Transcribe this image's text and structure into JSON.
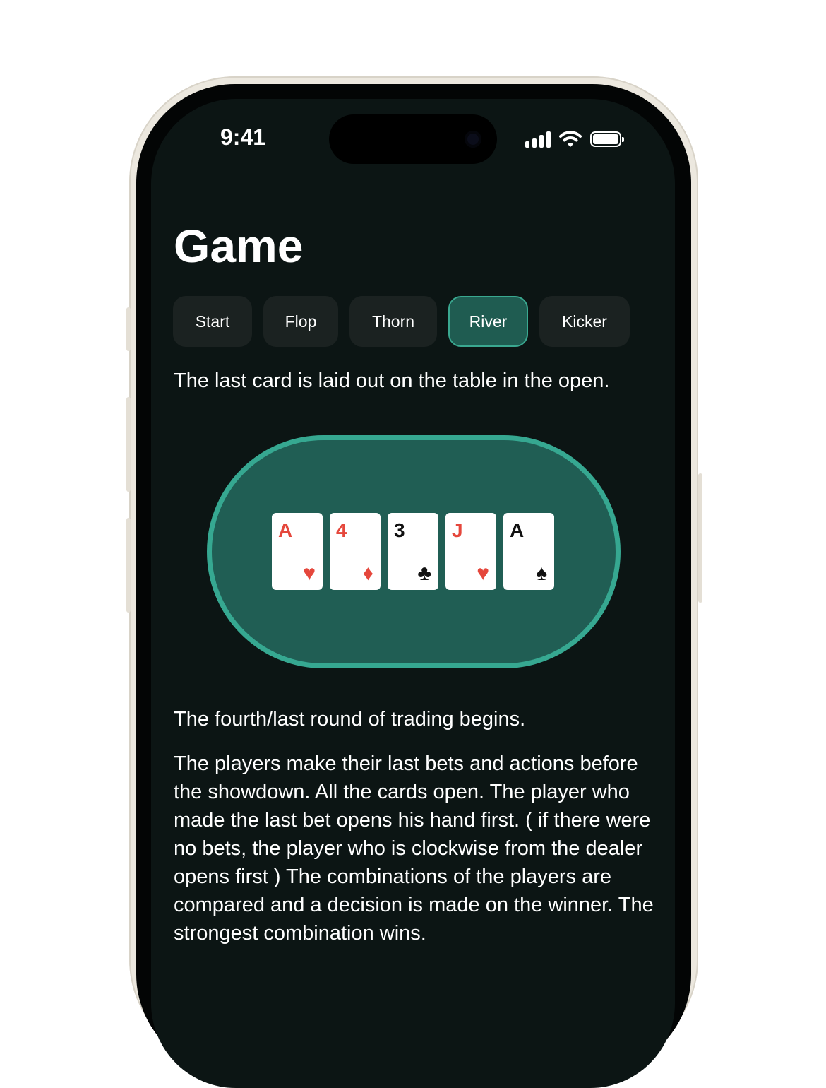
{
  "status_bar": {
    "time": "9:41",
    "icons": [
      "cellular-signal-icon",
      "wifi-icon",
      "battery-icon"
    ]
  },
  "screen": {
    "title": "Game",
    "tabs": [
      {
        "label": "Start",
        "active": false
      },
      {
        "label": "Flop",
        "active": false
      },
      {
        "label": "Thorn",
        "active": false
      },
      {
        "label": "River",
        "active": true
      },
      {
        "label": "Kicker",
        "active": false
      }
    ],
    "caption": "The last card is laid out on the table in the open.",
    "cards": [
      {
        "rank": "A",
        "suit": "♥",
        "suit_name": "hearts",
        "color": "red"
      },
      {
        "rank": "4",
        "suit": "♦",
        "suit_name": "diamonds",
        "color": "red"
      },
      {
        "rank": "3",
        "suit": "♣",
        "suit_name": "clubs",
        "color": "black"
      },
      {
        "rank": "J",
        "suit": "♥",
        "suit_name": "hearts",
        "color": "red"
      },
      {
        "rank": "A",
        "suit": "♠",
        "suit_name": "spades",
        "color": "black"
      }
    ],
    "paragraph_1": "The fourth/last round of trading begins.",
    "paragraph_2": "The players make their last bets and actions before the showdown. All the cards open. The player who made the last bet opens his hand first. ( if there were no bets, the player who is clockwise from the dealer opens first ) The combinations of the players are compared and a decision is made on the winner. The strongest combination wins."
  },
  "colors": {
    "background": "#0c1514",
    "accent": "#36a891",
    "table_felt": "#205e54",
    "tab_bg": "#1b2221",
    "red_suit": "#e5473c"
  }
}
